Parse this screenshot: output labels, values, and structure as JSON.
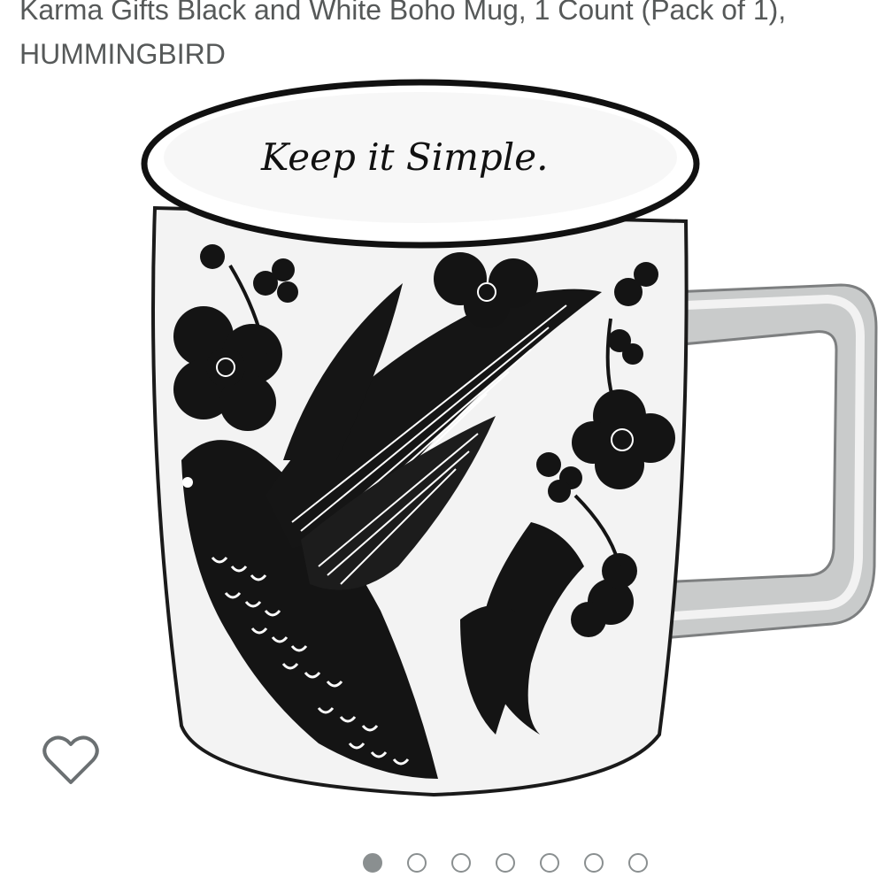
{
  "product": {
    "title_line_1": "Karma Gifts Black and White Boho Mug, 1 Count (Pack of 1),",
    "title_line_2": "HUMMINGBIRD"
  },
  "image": {
    "mug_inscription": "Keep it Simple."
  },
  "wishlist": {
    "icon": "heart-outline-icon"
  },
  "carousel": {
    "total_images": 7,
    "active_index": 0,
    "dot_color": "#8a8f90"
  }
}
